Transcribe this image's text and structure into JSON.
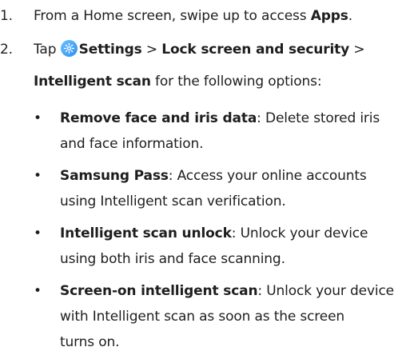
{
  "steps": [
    {
      "number": "1.",
      "text_before": "From a Home screen, swipe up to access ",
      "bold": "Apps",
      "text_after": "."
    },
    {
      "number": "2.",
      "tap": "Tap",
      "icon": "settings-gear-icon",
      "settings": "Settings",
      "sep1": " > ",
      "lock": "Lock screen and security",
      "sep2": " >",
      "intelligent_scan": "Intelligent scan",
      "text_after": " for the following options:"
    }
  ],
  "bullets": [
    {
      "title": "Remove face and iris data",
      "line1_rest": ": Delete stored iris",
      "line2": "and face information."
    },
    {
      "title": "Samsung Pass",
      "line1_rest": ": Access your online accounts",
      "line2": "using Intelligent scan verification."
    },
    {
      "title": "Intelligent scan unlock",
      "line1_rest": ": Unlock your device",
      "line2": "using both iris and face scanning."
    },
    {
      "title": "Screen-on intelligent scan",
      "line1_rest": ": Unlock your device",
      "line2": "with Intelligent scan as soon as the screen",
      "line3": "turns on."
    }
  ],
  "bullet_glyph": "•",
  "colors": {
    "text": "#1e1e1e",
    "icon_start": "#67c2ff",
    "icon_end": "#2f8ff0"
  }
}
